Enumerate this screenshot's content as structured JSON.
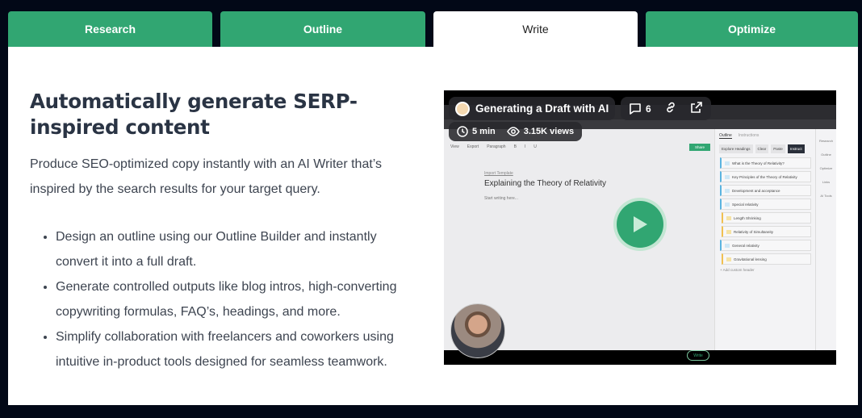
{
  "tabs": [
    {
      "label": "Research"
    },
    {
      "label": "Outline"
    },
    {
      "label": "Write",
      "active": true
    },
    {
      "label": "Optimize"
    }
  ],
  "content": {
    "heading": "Automatically generate SERP-inspired content",
    "lead": "Produce SEO-optimized copy instantly with an AI Writer that’s inspired by the search results for your target query.",
    "bullets": [
      "Design an outline using our Outline Builder and instantly convert it into a full draft.",
      "Generate controlled outputs like blog intros, high-converting copywriting formulas, FAQ’s, headings, and more.",
      "Simplify collaboration with freelancers and coworkers using intuitive in-product tools designed for seamless teamwork."
    ]
  },
  "video": {
    "title": "Generating a Draft with AI",
    "comments": "6",
    "duration": "5 min",
    "views": "3.15K views",
    "icons": [
      "comment-icon",
      "link-icon",
      "external-link-icon",
      "clock-icon",
      "eye-icon",
      "play-icon"
    ],
    "app": {
      "import_template": "Import Template",
      "doc_title": "Explaining the Theory of Relativity",
      "placeholder": "Start writing here...",
      "share": "Share",
      "write": "Write",
      "toolbar": [
        "View",
        "Export",
        "Paragraph",
        "B",
        "I",
        "U"
      ],
      "side_tabs": [
        "Outline",
        "Instructions"
      ],
      "side_buttons": [
        "Explore Headings",
        "Clear",
        "Paste",
        "Instruct"
      ],
      "outline": [
        {
          "level": "H2",
          "text": "What is the Theory of Relativity?"
        },
        {
          "level": "H2",
          "text": "Key Principles of the Theory of Relativity"
        },
        {
          "level": "H2",
          "text": "Development and acceptance"
        },
        {
          "level": "H2",
          "text": "Special relativity"
        },
        {
          "level": "H3",
          "text": "Length Shrinking"
        },
        {
          "level": "H3",
          "text": "Relativity of Simultaneity"
        },
        {
          "level": "H2",
          "text": "General relativity"
        },
        {
          "level": "H3",
          "text": "Gravitational lensing"
        }
      ],
      "add_header": "+ Add custom header",
      "rail": [
        "Research",
        "Outline",
        "Optimize",
        "Links",
        "AI Tools"
      ]
    }
  },
  "colors": {
    "accent": "#31a672",
    "background": "#020817",
    "heading": "#2a3444"
  }
}
